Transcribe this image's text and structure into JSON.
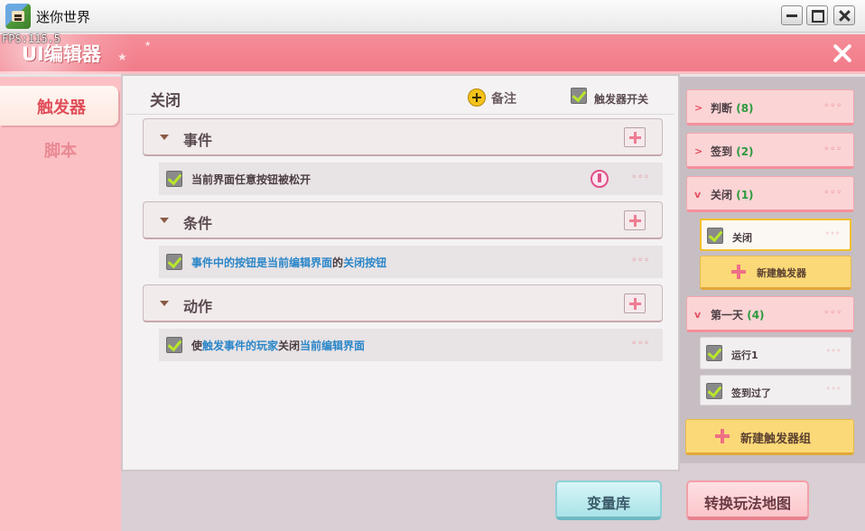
{
  "window": {
    "app_title": "迷你世界",
    "fps_text": "FPS:115.5",
    "controls": [
      "minimize",
      "maximize",
      "close"
    ]
  },
  "header": {
    "title": "UI编辑器"
  },
  "sidebar": {
    "tabs": [
      {
        "label": "触发器",
        "active": true
      },
      {
        "label": "脚本",
        "active": false
      }
    ]
  },
  "main": {
    "title": "关闭",
    "note_label": "备注",
    "trigger_switch_label": "触发器开关",
    "trigger_switch_checked": true,
    "sections": [
      {
        "title": "事件",
        "item": {
          "text_parts": [
            "当前界面任意按钮被松开"
          ],
          "checked": true,
          "warning": true
        }
      },
      {
        "title": "条件",
        "item": {
          "text_parts": [
            "事件中的按钮",
            "是",
            "当前编辑界面",
            "的",
            "关闭按钮"
          ],
          "checked": true
        }
      },
      {
        "title": "动作",
        "item": {
          "text_parts": [
            "使",
            "触发事件的玩家",
            "关闭",
            "当前编辑界面"
          ],
          "checked": true
        }
      }
    ]
  },
  "right_panel": {
    "groups": [
      {
        "label": "判断",
        "count": "(8)",
        "expanded": false
      },
      {
        "label": "签到",
        "count": "(2)",
        "expanded": false
      },
      {
        "label": "关闭",
        "count": "(1)",
        "expanded": true
      },
      {
        "label": "第一天",
        "count": "(4)",
        "expanded": true
      }
    ],
    "triggers": [
      {
        "label": "关闭",
        "selected": true
      },
      {
        "label": "运行1",
        "selected": false
      },
      {
        "label": "签到过了",
        "selected": false
      }
    ],
    "new_trigger_label": "新建触发器",
    "new_group_label": "新建触发器组",
    "more_icon_text": "◦◦◦"
  },
  "bottom": {
    "variable_library_label": "变量库",
    "switch_map_label": "转换玩法地图"
  },
  "colors": {
    "header_pink": "#f17b88",
    "sidebar_pink": "#fbc0c4",
    "accent_red": "#e04d5a",
    "highlight_blue": "#2a86c8",
    "count_green": "#2c9a3e",
    "new_button_yellow": "#fbd978"
  }
}
